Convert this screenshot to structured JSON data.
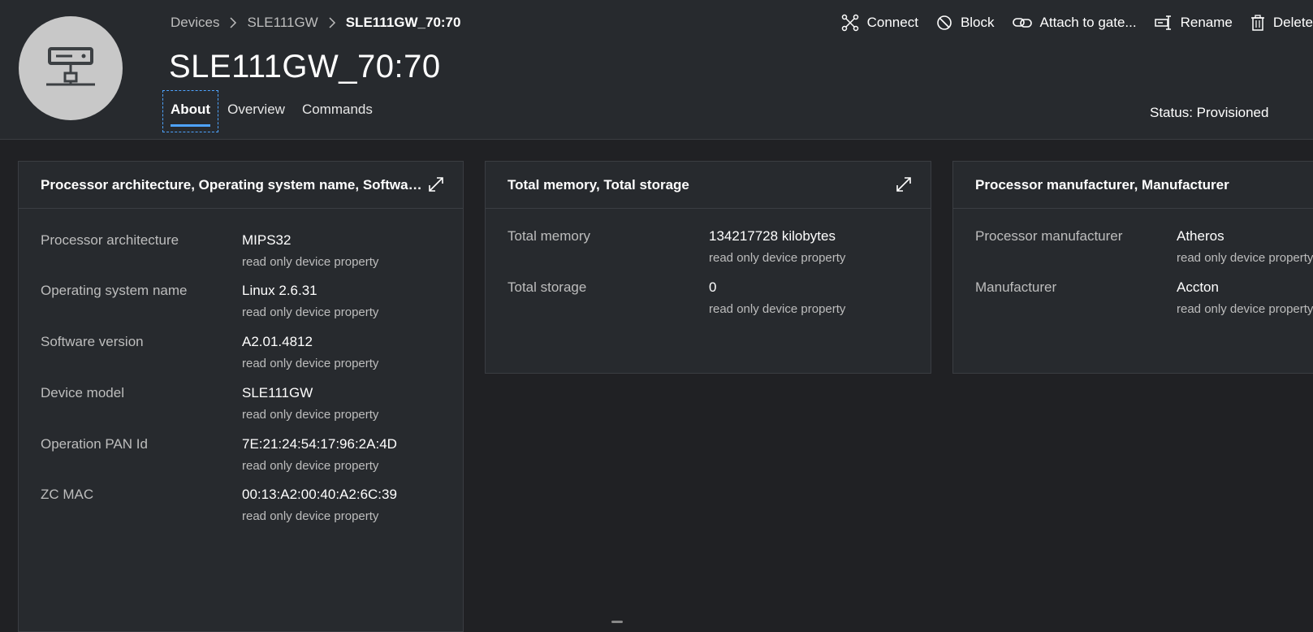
{
  "breadcrumb": {
    "items": [
      "Devices",
      "SLE111GW"
    ],
    "current": "SLE111GW_70:70"
  },
  "title": "SLE111GW_70:70",
  "tabs": [
    "About",
    "Overview",
    "Commands"
  ],
  "toolbar": {
    "connect": "Connect",
    "block": "Block",
    "attach": "Attach to gate...",
    "rename": "Rename",
    "delete": "Delete"
  },
  "status": "Status: Provisioned",
  "cards": [
    {
      "title": "Processor architecture, Operating system name, Softwar...",
      "rows": [
        {
          "label": "Processor architecture",
          "value": "MIPS32",
          "sub": "read only device property"
        },
        {
          "label": "Operating system name",
          "value": "Linux 2.6.31",
          "sub": "read only device property"
        },
        {
          "label": "Software version",
          "value": "A2.01.4812",
          "sub": "read only device property"
        },
        {
          "label": "Device model",
          "value": "SLE111GW",
          "sub": "read only device property"
        },
        {
          "label": "Operation PAN Id",
          "value": "7E:21:24:54:17:96:2A:4D",
          "sub": "read only device property"
        },
        {
          "label": "ZC MAC",
          "value": "00:13:A2:00:40:A2:6C:39",
          "sub": "read only device property"
        }
      ]
    },
    {
      "title": "Total memory, Total storage",
      "rows": [
        {
          "label": "Total memory",
          "value": "134217728 kilobytes",
          "sub": "read only device property"
        },
        {
          "label": "Total storage",
          "value": "0",
          "sub": "read only device property"
        }
      ]
    },
    {
      "title": "Processor manufacturer, Manufacturer",
      "rows": [
        {
          "label": "Processor manufacturer",
          "value": "Atheros",
          "sub": "read only device property"
        },
        {
          "label": "Manufacturer",
          "value": "Accton",
          "sub": "read only device property"
        }
      ]
    }
  ]
}
